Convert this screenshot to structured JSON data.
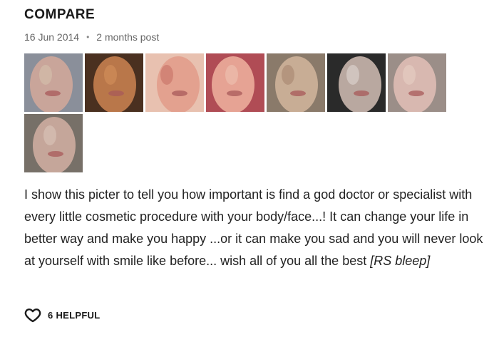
{
  "post": {
    "title": "COMPARE",
    "date": "16 Jun 2014",
    "separator": "•",
    "relative_time": "2 months post",
    "body": "I show this picter to tell you how important is find a god doctor or specialist with every little cosmetic procedure with your body/face...! It can change your life in better way and make you happy ...or it can make you sad and you will never look at yourself with smile like before... wish all of you all the best ",
    "body_tag": "[RS bleep]"
  },
  "photos": [
    {
      "bg": "#8a8f9a",
      "skin": "#c9a59a",
      "accent": "#d8c7b0"
    },
    {
      "bg": "#4a3020",
      "skin": "#b9774a",
      "accent": "#d9955e"
    },
    {
      "bg": "#e8c1b0",
      "skin": "#e3a18f",
      "accent": "#c2685e"
    },
    {
      "bg": "#b04c55",
      "skin": "#e6a394",
      "accent": "#f0c9b8"
    },
    {
      "bg": "#8a7a6a",
      "skin": "#c8ad95",
      "accent": "#a07e68"
    },
    {
      "bg": "#2a2a2a",
      "skin": "#b9a8a0",
      "accent": "#e7dfdc"
    },
    {
      "bg": "#9b8e88",
      "skin": "#d8b8b0",
      "accent": "#ead3c8"
    },
    {
      "bg": "#777068",
      "skin": "#c5a69a",
      "accent": "#e0ccc0"
    }
  ],
  "helpful": {
    "icon": "heart-icon",
    "label": "6 HELPFUL"
  }
}
